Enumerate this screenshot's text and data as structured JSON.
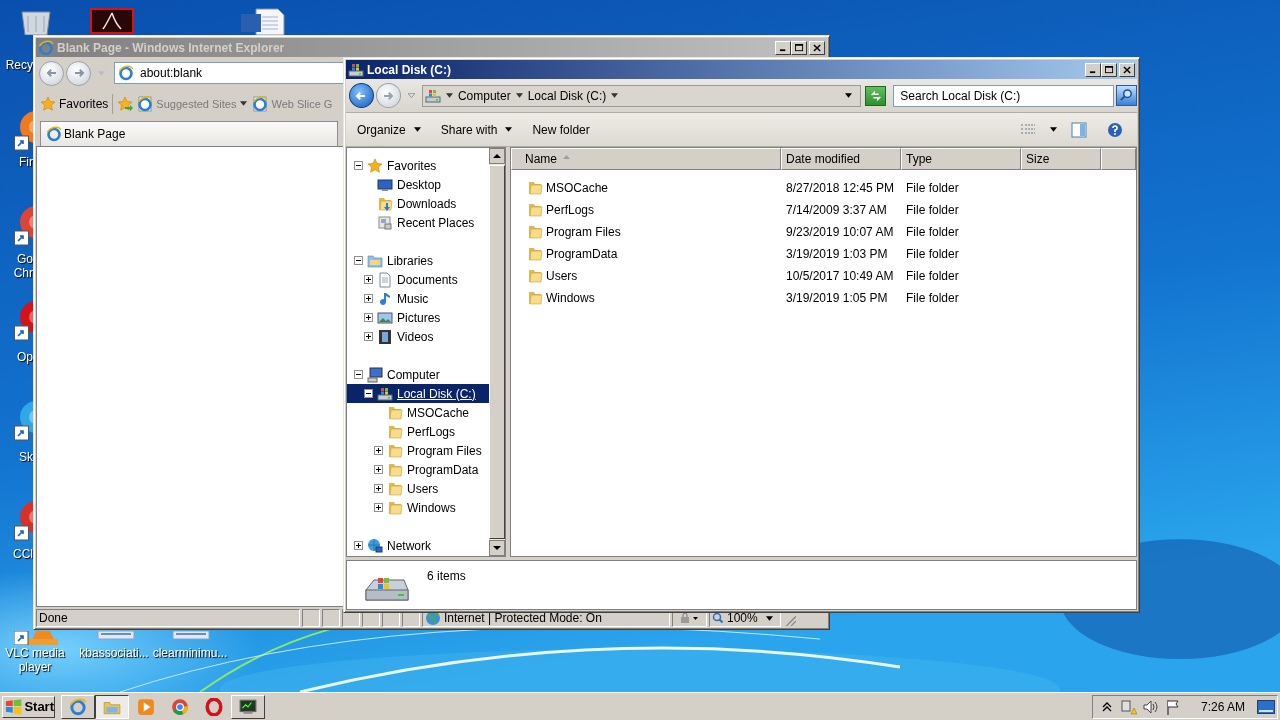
{
  "desktop_icons": [
    {
      "kind": "recycle-bin",
      "label": "Recy"
    },
    {
      "kind": "pdf"
    },
    {
      "kind": "word"
    },
    {
      "kind": "firefox",
      "label": "Fir"
    },
    {
      "kind": "chrome",
      "label": "Go Chr"
    },
    {
      "kind": "opera",
      "label": "Op"
    },
    {
      "kind": "skype",
      "label": "Sk"
    },
    {
      "kind": "ccleaner",
      "label": "CCl"
    },
    {
      "kind": "vlc",
      "label": "VLC media player"
    },
    {
      "kind": "file",
      "label": "kbassociati..."
    },
    {
      "kind": "file",
      "label": "clearminimu..."
    }
  ],
  "browser": {
    "title": "Blank Page - Windows Internet Explorer",
    "address": "about:blank",
    "favorites_button": "Favorites",
    "favorites_links": [
      {
        "label": "Suggested Sites",
        "dropdown": true
      },
      {
        "label": "Web Slice G",
        "dropdown": false
      }
    ],
    "tab": "Blank Page",
    "status": "Done",
    "zone": "Internet | Protected Mode: On",
    "zoom": "100%"
  },
  "explorer": {
    "title": "Local Disk (C:)",
    "breadcrumb": [
      "Computer",
      "Local Disk (C:)"
    ],
    "search_placeholder": "Search Local Disk (C:)",
    "commands": [
      {
        "label": "Organize",
        "dropdown": true
      },
      {
        "label": "Share with",
        "dropdown": true
      },
      {
        "label": "New folder",
        "dropdown": false
      }
    ],
    "tree": [
      {
        "label": "Favorites",
        "kind": "star",
        "expanded": true,
        "selected": false,
        "children": [
          {
            "label": "Desktop",
            "kind": "desktop",
            "selected": false
          },
          {
            "label": "Downloads",
            "kind": "downloads",
            "selected": false
          },
          {
            "label": "Recent Places",
            "kind": "recent",
            "selected": false
          }
        ]
      },
      {
        "label": "Libraries",
        "kind": "library",
        "expanded": true,
        "selected": false,
        "children": [
          {
            "label": "Documents",
            "kind": "document",
            "expanded": false,
            "selected": false
          },
          {
            "label": "Music",
            "kind": "music",
            "expanded": false,
            "selected": false
          },
          {
            "label": "Pictures",
            "kind": "pictures",
            "expanded": false,
            "selected": false
          },
          {
            "label": "Videos",
            "kind": "videos",
            "expanded": false,
            "selected": false
          }
        ]
      },
      {
        "label": "Computer",
        "kind": "computer",
        "expanded": true,
        "selected": false,
        "children": [
          {
            "label": "Local Disk (C:)",
            "kind": "drive",
            "expanded": true,
            "selected": true,
            "children": [
              {
                "label": "MSOCache",
                "kind": "folder",
                "selected": false
              },
              {
                "label": "PerfLogs",
                "kind": "folder",
                "selected": false
              },
              {
                "label": "Program Files",
                "kind": "folder",
                "expanded": false,
                "selected": false
              },
              {
                "label": "ProgramData",
                "kind": "folder",
                "expanded": false,
                "selected": false
              },
              {
                "label": "Users",
                "kind": "folder",
                "expanded": false,
                "selected": false
              },
              {
                "label": "Windows",
                "kind": "folder",
                "expanded": false,
                "selected": false
              }
            ]
          }
        ]
      },
      {
        "label": "Network",
        "kind": "network",
        "expanded": false,
        "selected": false
      }
    ],
    "columns": [
      {
        "label": "Name",
        "sorted": true
      },
      {
        "label": "Date modified",
        "sorted": false
      },
      {
        "label": "Type",
        "sorted": false
      },
      {
        "label": "Size",
        "sorted": false
      }
    ],
    "rows": [
      {
        "name": "MSOCache",
        "date_modified": "8/27/2018 12:45 PM",
        "type": "File folder"
      },
      {
        "name": "PerfLogs",
        "date_modified": "7/14/2009 3:37 AM",
        "type": "File folder"
      },
      {
        "name": "Program Files",
        "date_modified": "9/23/2019 10:07 AM",
        "type": "File folder"
      },
      {
        "name": "ProgramData",
        "date_modified": "3/19/2019 1:03 PM",
        "type": "File folder"
      },
      {
        "name": "Users",
        "date_modified": "10/5/2017 10:49 AM",
        "type": "File folder"
      },
      {
        "name": "Windows",
        "date_modified": "3/19/2019 1:05 PM",
        "type": "File folder"
      }
    ],
    "item_count": "6 items"
  },
  "taskbar": {
    "start": "Start",
    "apps": [
      {
        "kind": "ie",
        "running": true,
        "selected": false
      },
      {
        "kind": "explorer",
        "running": true,
        "selected": true
      },
      {
        "kind": "media",
        "running": false,
        "selected": false
      },
      {
        "kind": "chrome",
        "running": false,
        "selected": false
      },
      {
        "kind": "opera",
        "running": false,
        "selected": false
      },
      {
        "kind": "terminal",
        "running": true,
        "selected": false
      }
    ],
    "clock": "7:26 AM"
  }
}
